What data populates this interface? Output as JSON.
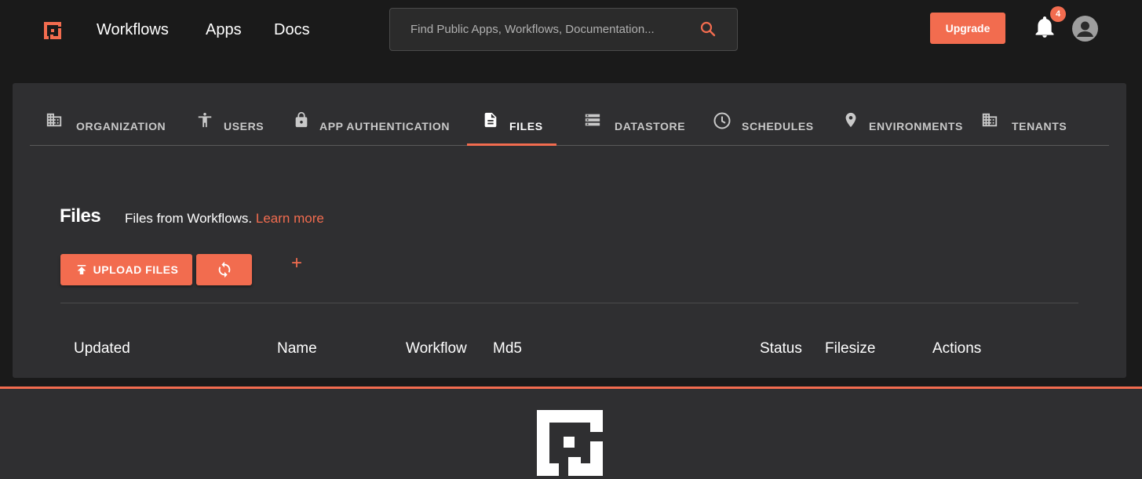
{
  "colors": {
    "accent": "#f26c4f",
    "panel": "#2f2f31",
    "background": "#1a1a1a"
  },
  "navbar": {
    "logo_icon": "shuffle-logo-icon",
    "links": [
      "Workflows",
      "Apps",
      "Docs"
    ],
    "search": {
      "placeholder": "Find Public Apps, Workflows, Documentation...",
      "icon": "search-icon"
    },
    "upgrade_label": "Upgrade",
    "notifications": {
      "icon": "bell-icon",
      "count": "4"
    },
    "avatar_icon": "account-circle-icon"
  },
  "tabs": [
    {
      "label": "ORGANIZATION",
      "icon": "business-icon"
    },
    {
      "label": "USERS",
      "icon": "accessibility-icon"
    },
    {
      "label": "APP AUTHENTICATION",
      "icon": "lock-icon"
    },
    {
      "label": "FILES",
      "icon": "description-icon",
      "active": true
    },
    {
      "label": "DATASTORE",
      "icon": "storage-icon"
    },
    {
      "label": "SCHEDULES",
      "icon": "clock-icon"
    },
    {
      "label": "ENVIRONMENTS",
      "icon": "location-pin-icon"
    },
    {
      "label": "TENANTS",
      "icon": "business-icon"
    }
  ],
  "files": {
    "title": "Files",
    "description": "Files from Workflows.",
    "learn_more": "Learn more",
    "upload_label": "UPLOAD FILES",
    "upload_icon": "upload-icon",
    "refresh_icon": "refresh-icon",
    "add_label": "+",
    "columns": [
      "Updated",
      "Name",
      "Workflow",
      "Md5",
      "Status",
      "Filesize",
      "Actions"
    ]
  },
  "footer": {
    "logo_icon": "shuffle-logo-icon"
  }
}
